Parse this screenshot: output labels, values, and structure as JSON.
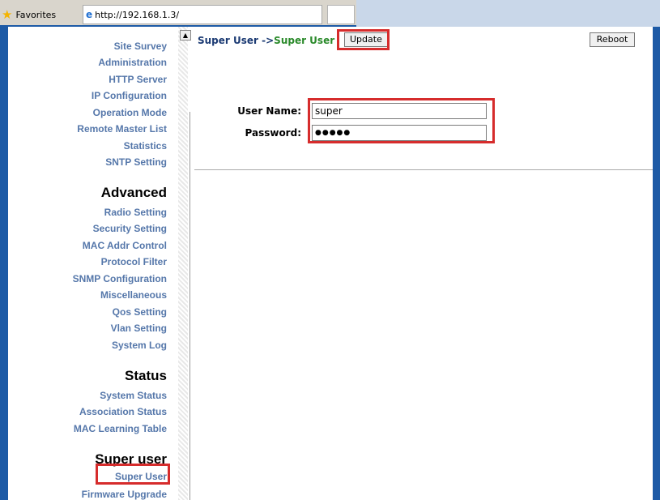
{
  "browser": {
    "favorites_label": "Favorites",
    "url": "http://192.168.1.3/"
  },
  "sidebar": {
    "group1": [
      {
        "label": "Site Survey"
      },
      {
        "label": "Administration"
      },
      {
        "label": "HTTP Server"
      },
      {
        "label": "IP Configuration"
      },
      {
        "label": "Operation Mode"
      },
      {
        "label": "Remote Master List"
      },
      {
        "label": "Statistics"
      },
      {
        "label": "SNTP Setting"
      }
    ],
    "advanced_heading": "Advanced",
    "advanced": [
      {
        "label": "Radio Setting"
      },
      {
        "label": "Security Setting"
      },
      {
        "label": "MAC Addr Control"
      },
      {
        "label": "Protocol Filter"
      },
      {
        "label": "SNMP Configuration"
      },
      {
        "label": "Miscellaneous"
      },
      {
        "label": "Qos Setting"
      },
      {
        "label": "Vlan Setting"
      },
      {
        "label": "System Log"
      }
    ],
    "status_heading": "Status",
    "status": [
      {
        "label": "System Status"
      },
      {
        "label": "Association Status"
      },
      {
        "label": "MAC Learning Table"
      }
    ],
    "superuser_heading": "Super user",
    "superuser": [
      {
        "label": "Super User"
      },
      {
        "label": "Firmware Upgrade"
      }
    ]
  },
  "main": {
    "crumb_parent": "Super User ->",
    "crumb_current": "Super User",
    "update_label": "Update",
    "reboot_label": "Reboot",
    "username_label": "User Name:",
    "username_value": "super",
    "password_label": "Password:",
    "password_value": "●●●●●"
  },
  "colors": {
    "highlight": "#d62c2c",
    "nav_link": "#5577aa",
    "frame_blue": "#1d5aa6"
  }
}
